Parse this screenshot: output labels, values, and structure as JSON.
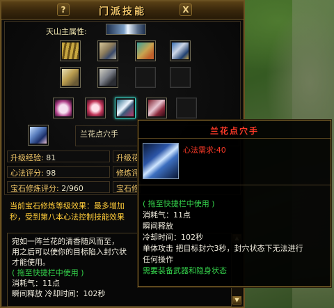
{
  "window": {
    "title": "门派技能",
    "help_label": "?",
    "close_label": "X"
  },
  "school": {
    "label": "天山主属性:"
  },
  "book_slots": [
    {
      "name": "book-1"
    },
    {
      "name": "book-2"
    },
    {
      "name": "book-3"
    },
    {
      "name": "book-4"
    },
    {
      "name": "book-5"
    },
    {
      "name": "book-6"
    },
    {
      "name": "empty"
    },
    {
      "name": "empty"
    }
  ],
  "skill_slots": [
    {
      "name": "sk-1"
    },
    {
      "name": "sk-2"
    },
    {
      "name": "sk-3",
      "selected": true
    },
    {
      "name": "sk-4"
    },
    {
      "name": "empty"
    }
  ],
  "selected_skill": {
    "name": "兰花点穴手"
  },
  "stats": {
    "upgrade_exp": {
      "label": "升级经验:",
      "value": "81"
    },
    "upgrade_next": {
      "label": "升级花",
      "value": ""
    },
    "heart_score": {
      "label": "心法评分:",
      "value": "98"
    },
    "cultivate": {
      "label": "修炼评",
      "value": ""
    },
    "gem_score": {
      "label": "宝石修炼评分:",
      "value": "2/960"
    },
    "gem_cut": {
      "label": "宝石修",
      "value": ""
    }
  },
  "effect_text": "当前宝石修炼等级效果：最多增加秒，受到第八本心法控制技能效果",
  "effect_lines": [
    "当前宝石修炼等级效果：最多增加",
    "秒，受到第八本心法控制技能效果"
  ],
  "description": {
    "lines": [
      "宛如一阵兰花的清香随风而至，",
      "用之后可以使你的目标陷入封穴状",
      "才能使用。"
    ],
    "drag_hint": "( 拖至快捷栏中使用 )",
    "cost": "消耗气：11点",
    "cast": "瞬间释放 冷却时间：102秒",
    "scroll_up": "▲",
    "scroll_down": "▼"
  },
  "tooltip": {
    "title": "兰花点穴手",
    "requirement": "心法需求:40",
    "drag_hint": "( 拖至快捷栏中使用 )",
    "cost": "消耗气：11点",
    "cast_type": "瞬间释放",
    "cooldown": "冷却时间：102秒",
    "effect_1": "单体攻击 把目标封穴3秒，封穴状态下无法进行",
    "effect_2": "任何操作",
    "requirement_2": "需要装备武器和隐身状态"
  },
  "colors": {
    "gold": "#f0c668",
    "red": "#ff3a28",
    "green": "#34d24b",
    "border": "#6b5222"
  }
}
